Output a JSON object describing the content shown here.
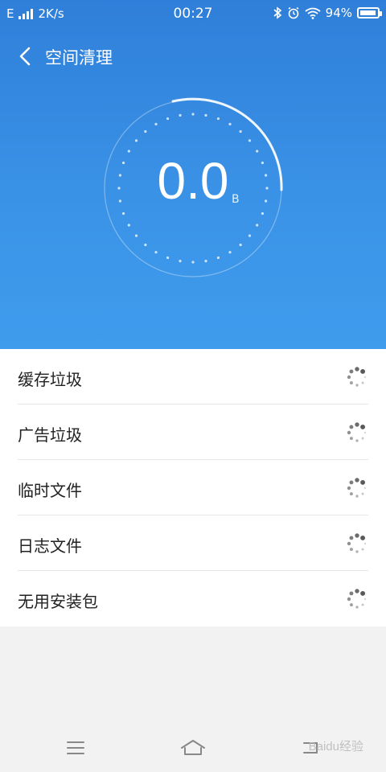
{
  "status_bar": {
    "network_type": "E",
    "speed": "2K/s",
    "time": "00:27",
    "battery_percent": "94%",
    "battery_level": 0.94,
    "icons": [
      "signal-icon",
      "bluetooth-icon",
      "alarm-icon",
      "wifi-icon",
      "battery-icon"
    ]
  },
  "header": {
    "title": "空间清理",
    "back_icon": "chevron-left-icon"
  },
  "scan": {
    "value": "0.0",
    "unit": "B"
  },
  "items": [
    {
      "label": "缓存垃圾"
    },
    {
      "label": "广告垃圾"
    },
    {
      "label": "临时文件"
    },
    {
      "label": "日志文件"
    },
    {
      "label": "无用安装包"
    }
  ],
  "nav": {
    "menu_icon": "menu-icon",
    "home_icon": "home-icon",
    "back_icon": "return-icon"
  },
  "watermark": "Baidu经验",
  "colors": {
    "accent_top": "#2f7fd9",
    "accent_bottom": "#3f9ced",
    "list_bg": "#ffffff",
    "page_bg": "#f2f2f2"
  }
}
